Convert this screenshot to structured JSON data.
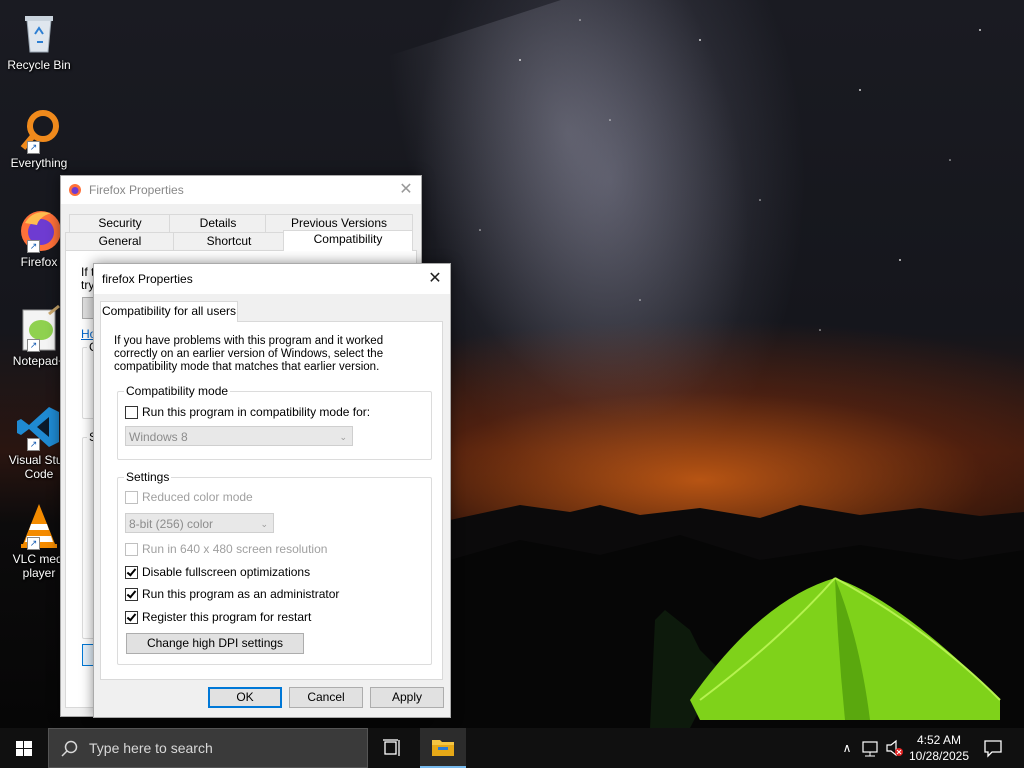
{
  "desktop": {
    "icons": [
      {
        "label": "Recycle Bin",
        "icon": "recycle-bin-icon"
      },
      {
        "label": "Everything",
        "icon": "everything-search-icon"
      },
      {
        "label": "Firefox",
        "icon": "firefox-icon"
      },
      {
        "label": "Notepad+",
        "icon": "notepad-plus-plus-icon"
      },
      {
        "label": "Visual Stud\nCode",
        "icon": "vscode-icon"
      },
      {
        "label": "VLC medi\nplayer",
        "icon": "vlc-icon"
      }
    ]
  },
  "back_window": {
    "title": "Firefox Properties",
    "tabs_row1": [
      "Security",
      "Details",
      "Previous Versions"
    ],
    "tabs_row2": [
      "General",
      "Shortcut",
      "Compatibility"
    ],
    "partial_text": [
      "If t",
      "try",
      "Ho",
      "C",
      "S"
    ]
  },
  "front_window": {
    "title": "firefox Properties",
    "tab": "Compatibility for all users",
    "description": "If you have problems with this program and it worked correctly on an earlier version of Windows, select the compatibility mode that matches that earlier version.",
    "compat_group": {
      "label": "Compatibility mode",
      "checkbox_label": "Run this program in compatibility mode for:",
      "checked": false,
      "os_select_value": "Windows 8"
    },
    "settings_group": {
      "label": "Settings",
      "reduced_color": {
        "label": "Reduced color mode",
        "checked": false,
        "enabled": false
      },
      "color_select_value": "8-bit (256) color",
      "res640": {
        "label": "Run in 640 x 480 screen resolution",
        "checked": false,
        "enabled": false
      },
      "fullscreen_opt": {
        "label": "Disable fullscreen optimizations",
        "checked": true
      },
      "run_as_admin": {
        "label": "Run this program as an administrator",
        "checked": true
      },
      "register_restart": {
        "label": "Register this program for restart",
        "checked": true
      },
      "dpi_button": "Change high DPI settings"
    },
    "buttons": {
      "ok": "OK",
      "cancel": "Cancel",
      "apply": "Apply"
    }
  },
  "taskbar": {
    "search_placeholder": "Type here to search",
    "clock_time": "4:52 AM",
    "clock_date": "10/28/2025"
  },
  "colors": {
    "accent": "#0078d7",
    "taskbar": "#101010",
    "tent": "#7fd21a"
  }
}
